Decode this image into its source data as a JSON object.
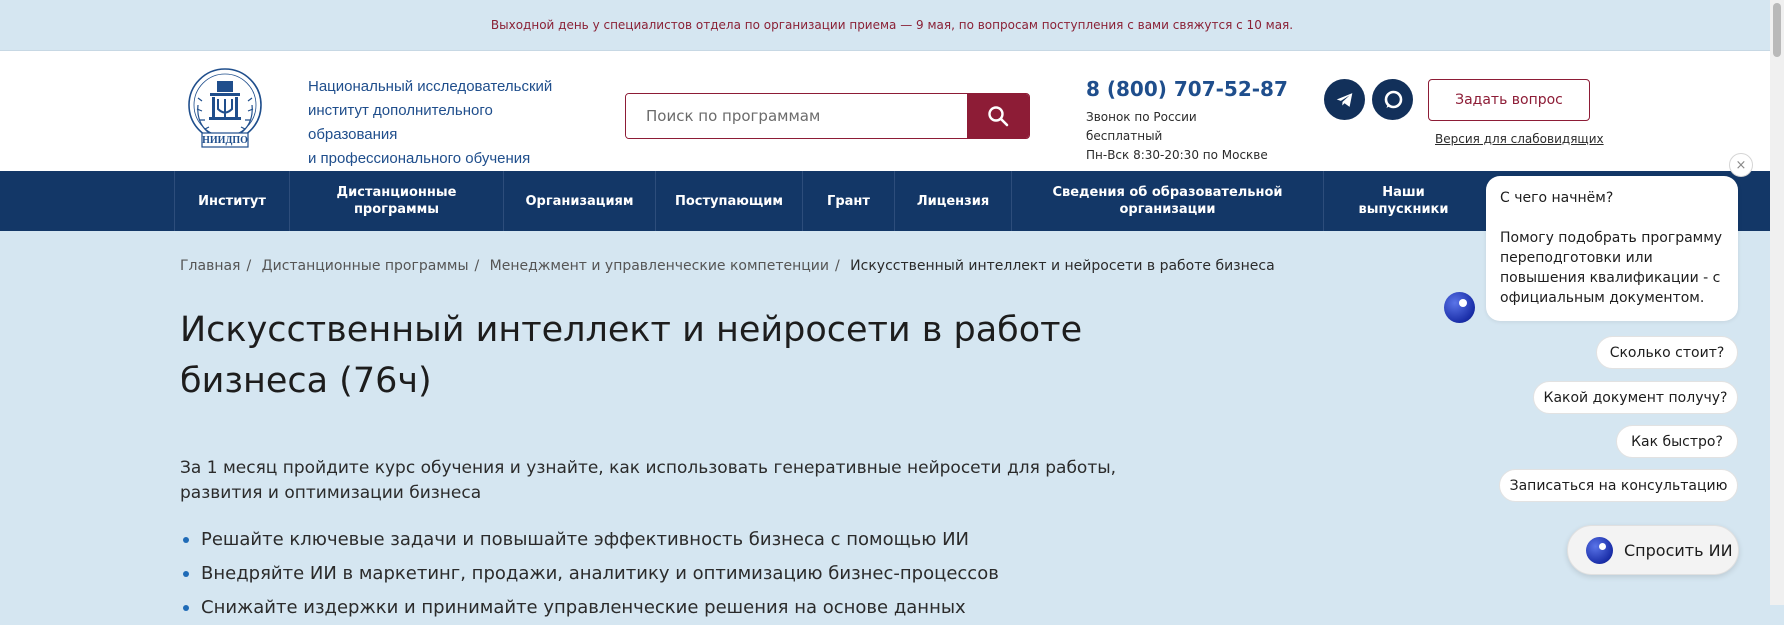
{
  "announcement": "Выходной день у специалистов отдела по организации приема — 9 мая, по вопросам поступления с вами свяжутся с 10 мая.",
  "logo": {
    "lines": [
      "Национальный исследовательский",
      "институт дополнительного образования",
      "и профессионального обучения"
    ],
    "emblem_text": "НИИДПО"
  },
  "search": {
    "placeholder": "Поиск по программам"
  },
  "contact": {
    "phone": "8 (800) 707-52-87",
    "note_line1": "Звонок по России бесплатный",
    "note_line2": "Пн-Вск 8:30-20:30 по Москве"
  },
  "header": {
    "ask_question": "Задать вопрос",
    "accessibility": "Версия для слабовидящих"
  },
  "nav": [
    {
      "label": "Институт"
    },
    {
      "label": "Дистанционные программы"
    },
    {
      "label": "Организациям"
    },
    {
      "label": "Поступающим"
    },
    {
      "label": "Грант"
    },
    {
      "label": "Лицензия"
    },
    {
      "label": "Сведения об образовательной организации"
    },
    {
      "label": "Наши выпускники"
    }
  ],
  "breadcrumb": [
    "Главная",
    "Дистанционные программы",
    "Менеджмент и управленческие компетенции",
    "Искусственный интеллект и нейросети в работе бизнеса"
  ],
  "breadcrumb_sep": "/",
  "page": {
    "title": "Искусственный интеллект и нейросети в работе бизнеса (76ч)",
    "lead": "За 1 месяц пройдите курс обучения и узнайте, как использовать генеративные нейросети для работы, развития и оптимизации бизнеса",
    "bullets": [
      "Решайте ключевые задачи и повышайте эффективность бизнеса с помощью ИИ",
      "Внедряйте ИИ в маркетинг, продажи, аналитику и оптимизацию бизнес-процессов",
      "Снижайте издержки и принимайте управленческие решения на основе данных"
    ]
  },
  "chat": {
    "close": "×",
    "greeting": "С чего начнём?",
    "message": "Помогу подобрать программу переподготовки или повышения квалификации - с официальным документом.",
    "chips": [
      "Сколько стоит?",
      "Какой документ получу?",
      "Как быстро?",
      "Записаться на консультацию"
    ],
    "ask_ai": "Спросить ИИ"
  },
  "colors": {
    "brand_red": "#8d1c36",
    "nav_blue": "#133767",
    "link_blue": "#1f4e8c",
    "page_bg": "#d5e6f1"
  }
}
